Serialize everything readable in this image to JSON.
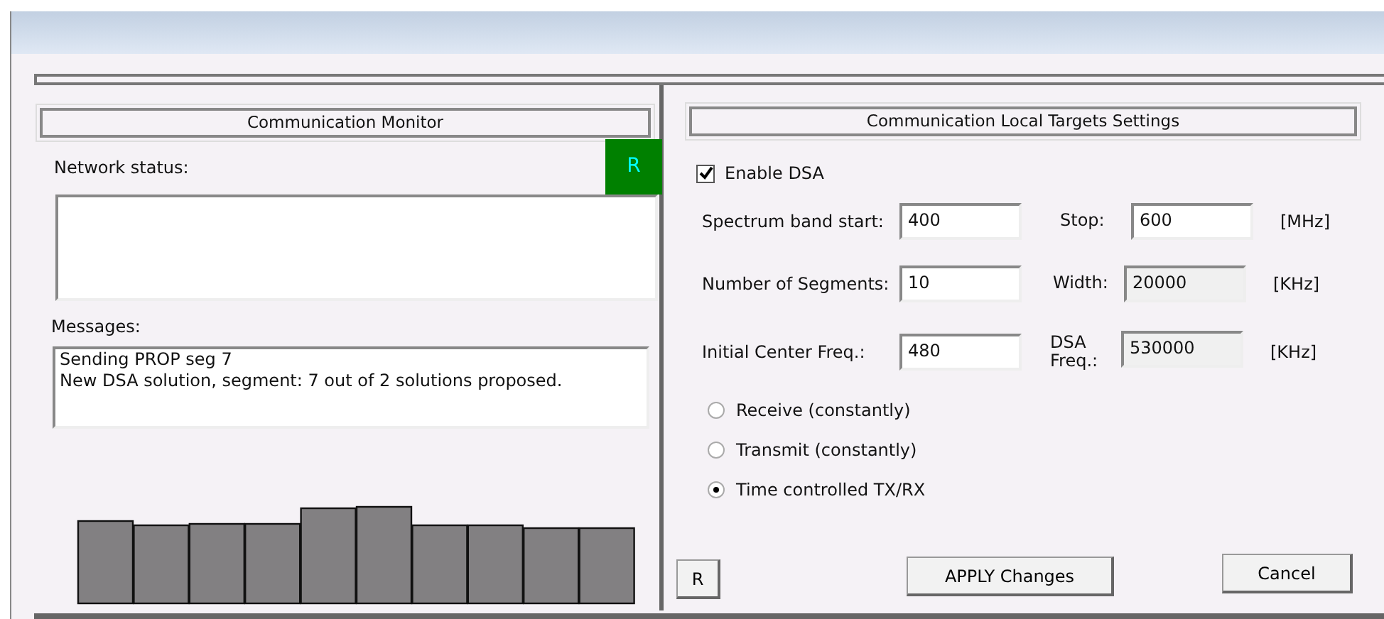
{
  "left_panel": {
    "title": "Communication Monitor",
    "status_indicator": "R",
    "network_status_label": "Network status:",
    "messages_label": "Messages:",
    "messages": [
      "Sending PROP seg 7",
      "New DSA solution, segment: 7 out of 2 solutions proposed."
    ]
  },
  "right_panel": {
    "title": "Communication Local Targets Settings",
    "enable_dsa": {
      "label": "Enable DSA",
      "checked": true
    },
    "rows": [
      {
        "label": "Spectrum band start:",
        "value": "400",
        "label_2": "Stop:",
        "value_2": "600",
        "readonly_2": false,
        "unit": "[MHz]"
      },
      {
        "label": "Number of Segments:",
        "value": "10",
        "label_2": "Width:",
        "value_2": "20000",
        "readonly_2": true,
        "unit": "[KHz]"
      },
      {
        "label": "Initial Center Freq.:",
        "value": "480",
        "label_2": "DSA Freq.:",
        "value_2": "530000",
        "readonly_2": true,
        "unit": "[KHz]"
      }
    ],
    "modes": [
      {
        "label": "Receive (constantly)",
        "selected": false
      },
      {
        "label": "Transmit (constantly)",
        "selected": false
      },
      {
        "label": "Time controlled TX/RX",
        "selected": true
      }
    ],
    "buttons": [
      "R",
      "APPLY Changes",
      "Cancel"
    ]
  }
}
